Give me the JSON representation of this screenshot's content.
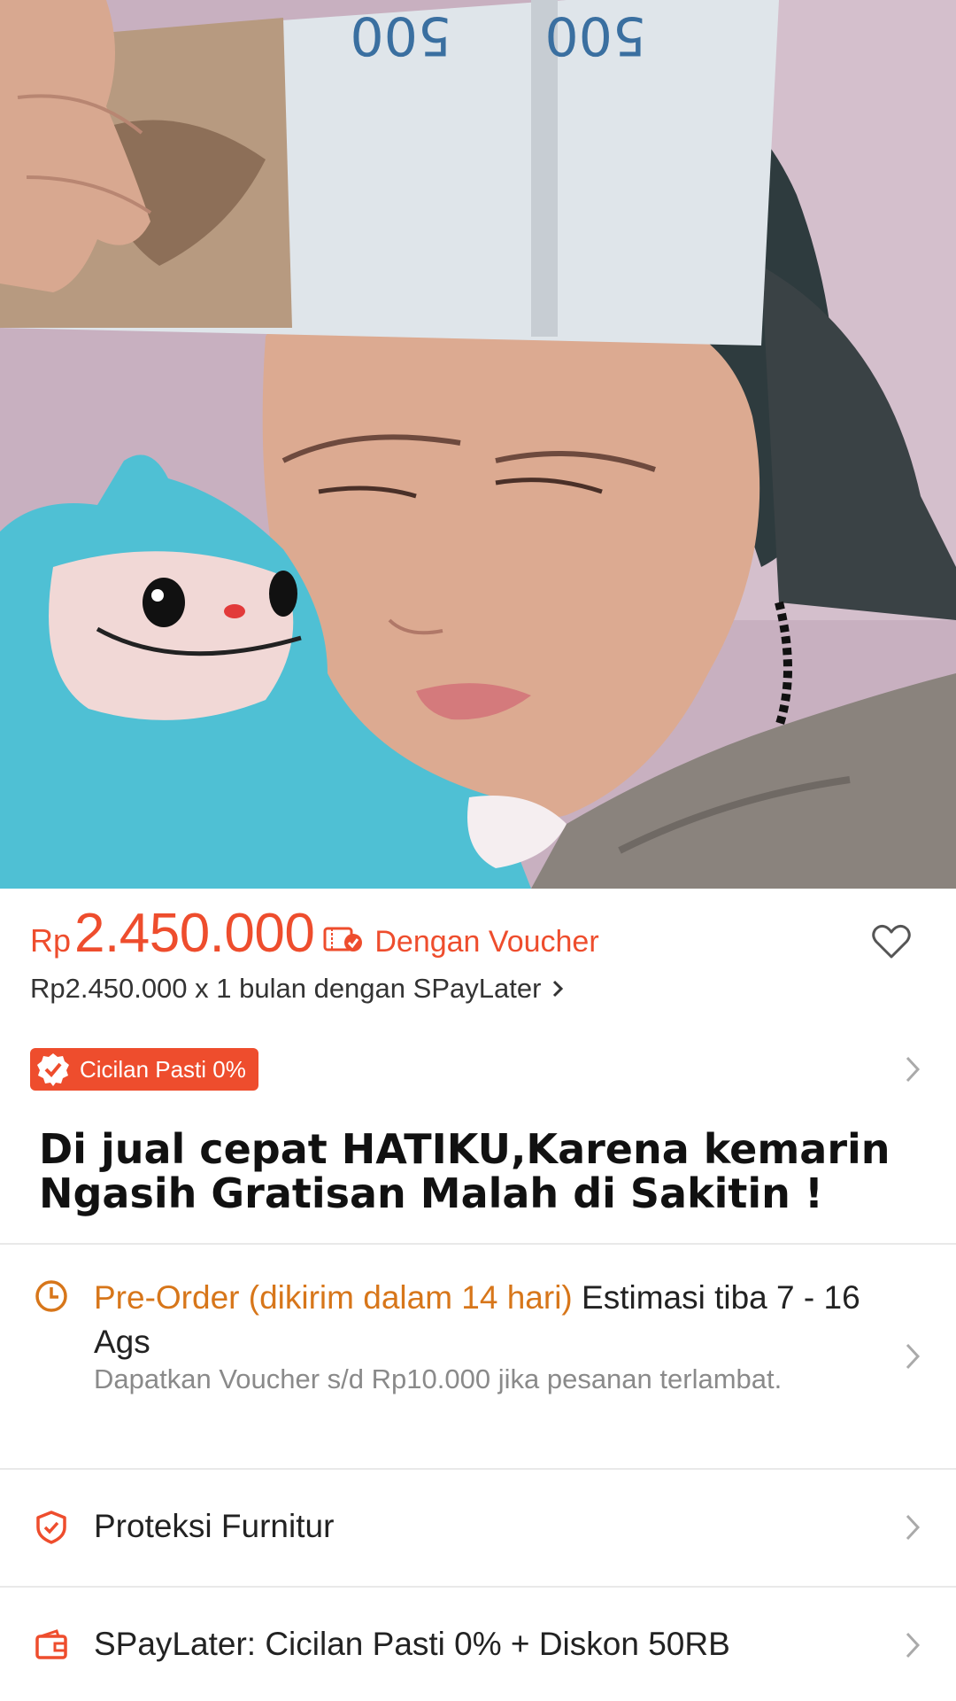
{
  "product": {
    "price_currency": "Rp",
    "price_value": "2.450.000",
    "voucher_label": "Dengan Voucher",
    "spaylater_line": "Rp2.450.000 x 1 bulan dengan SPayLater",
    "cicilan_badge": "Cicilan Pasti 0%",
    "title": "Di jual cepat HATIKU,Karena kemarin Ngasih Gratisan Malah di Sakitin !"
  },
  "shipping": {
    "preorder_label": "Pre-Order (dikirim dalam 14 hari)",
    "estimate": "Estimasi tiba 7 - 16 Ags",
    "voucher_note": "Dapatkan Voucher s/d Rp10.000 jika pesanan terlambat."
  },
  "protection": {
    "label": "Proteksi Furnitur"
  },
  "spaylater_promo": {
    "label": "SPayLater: Cicilan Pasti 0% + Diskon 50RB"
  },
  "banknote": {
    "denomination_left": "500",
    "denomination_right": "500"
  },
  "colors": {
    "accent": "#ee4d2d",
    "preorder": "#d7761a"
  },
  "icons": [
    "voucher-icon",
    "heart-icon",
    "chevron-right-icon",
    "check-badge-icon",
    "clock-icon",
    "shield-check-icon",
    "wallet-icon"
  ]
}
